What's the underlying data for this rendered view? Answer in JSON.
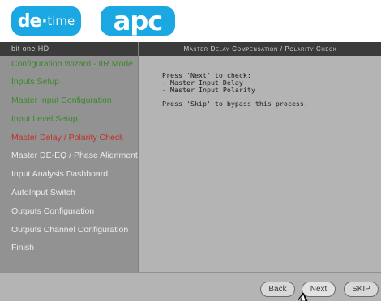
{
  "logos": {
    "de_brand": "de",
    "de_dot": "·",
    "de_suffix": "time",
    "apc": "apc"
  },
  "sidebar": {
    "header": "bit one HD",
    "items": [
      {
        "label": "Configuration Wizard - IIR Mode",
        "state": "done"
      },
      {
        "label": "Inputs Setup",
        "state": "done"
      },
      {
        "label": "Master Input Configuration",
        "state": "done"
      },
      {
        "label": "Input Level Setup",
        "state": "done"
      },
      {
        "label": "Master Delay / Polarity Check",
        "state": "current"
      },
      {
        "label": "Master DE-EQ / Phase Alignment",
        "state": "pending"
      },
      {
        "label": "Input Analysis Dashboard",
        "state": "pending"
      },
      {
        "label": "AutoInput Switch",
        "state": "pending"
      },
      {
        "label": "Outputs Configuration",
        "state": "pending"
      },
      {
        "label": "Outputs Channel Configuration",
        "state": "pending"
      },
      {
        "label": "Finish",
        "state": "pending"
      }
    ]
  },
  "main": {
    "header": "Master Delay Compensation / Polarity Check",
    "lines": [
      "Press 'Next' to check:",
      "- Master Input Delay",
      "- Master Input Polarity",
      "Press 'Skip' to bypass this process."
    ]
  },
  "buttons": {
    "back": "Back",
    "next": "Next",
    "skip": "SKIP"
  },
  "colors": {
    "logo": "#1ba7e1",
    "done": "#3a8a2a",
    "current": "#c0302a",
    "pending": "#ececec",
    "header_bar": "#3b3b3b",
    "panel": "#b4b4b4",
    "sidebar": "#929292"
  },
  "icons": {
    "cursor": "mouse-pointer-icon"
  }
}
